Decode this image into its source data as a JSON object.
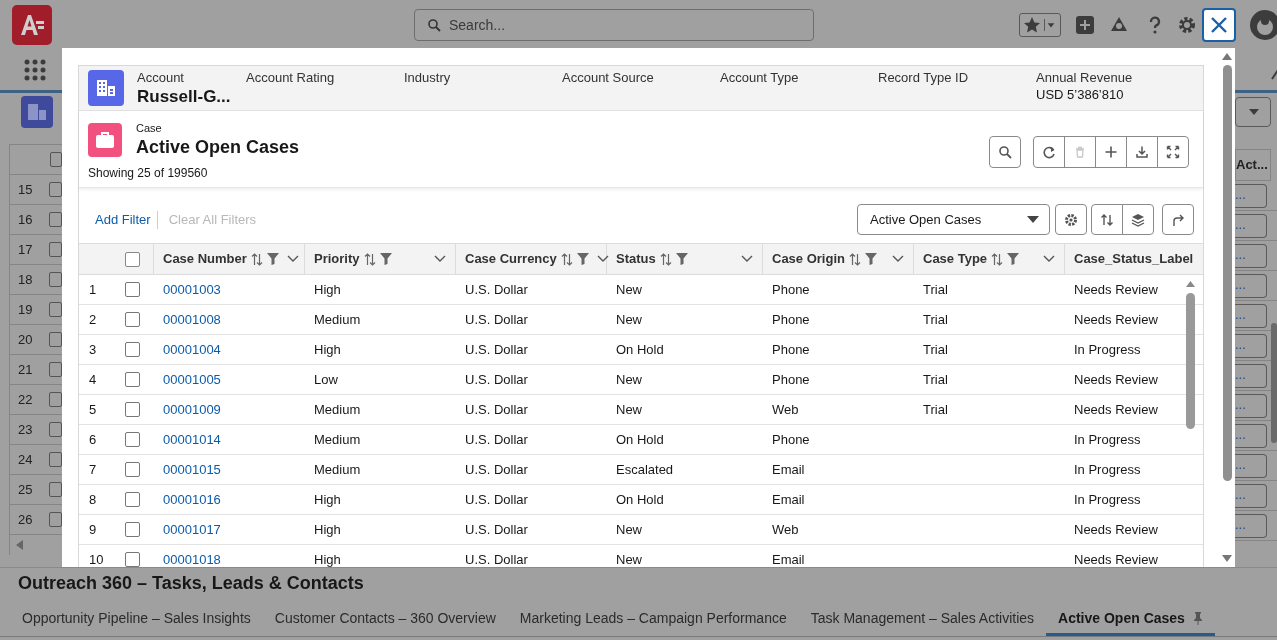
{
  "app": {
    "search_placeholder": "Search...",
    "left_all_checked": false,
    "left_rows": [
      {
        "n": "15",
        "checked": false
      },
      {
        "n": "16",
        "checked": false
      },
      {
        "n": "17",
        "checked": false
      },
      {
        "n": "18",
        "checked": false
      },
      {
        "n": "19",
        "checked": false
      },
      {
        "n": "20",
        "checked": false
      },
      {
        "n": "21",
        "checked": false
      },
      {
        "n": "22",
        "checked": false
      },
      {
        "n": "23",
        "checked": false
      },
      {
        "n": "24",
        "checked": false
      },
      {
        "n": "25",
        "checked": false
      },
      {
        "n": "26",
        "checked": false
      }
    ],
    "right_header": "Act...",
    "right_cells": [
      "...",
      "...",
      "...",
      "...",
      "...",
      "...",
      "...",
      "...",
      "...",
      "...",
      "...",
      "..."
    ],
    "workspace_title": "Outreach 360 – Tasks, Leads & Contacts",
    "tabs": [
      {
        "label": "Opportunity Pipeline – Sales Insights",
        "selected": false,
        "pinned": false
      },
      {
        "label": "Customer Contacts – 360 Overview",
        "selected": false,
        "pinned": false
      },
      {
        "label": "Marketing Leads – Campaign Performance",
        "selected": false,
        "pinned": false
      },
      {
        "label": "Task Management – Sales Activities",
        "selected": false,
        "pinned": false
      },
      {
        "label": "Active Open Cases",
        "selected": true,
        "pinned": true
      }
    ]
  },
  "modal": {
    "account": {
      "type": "Account",
      "name": "Russell-G...",
      "fields": [
        {
          "label": "Account Rating"
        },
        {
          "label": "Industry"
        },
        {
          "label": "Account Source"
        },
        {
          "label": "Account Type"
        },
        {
          "label": "Record Type ID"
        },
        {
          "label": "Annual Revenue",
          "value": "USD 5’386’810"
        }
      ]
    },
    "list": {
      "object": "Case",
      "title": "Active Open Cases",
      "count": "Showing 25 of 199560",
      "toolbar": [
        {
          "kind": "search",
          "disabled": false
        },
        {
          "kind": "refresh",
          "disabled": false
        },
        {
          "kind": "delete",
          "disabled": true
        },
        {
          "kind": "add",
          "disabled": false
        },
        {
          "kind": "download",
          "disabled": false
        },
        {
          "kind": "expand",
          "disabled": false
        }
      ]
    },
    "filters": {
      "add": "Add Filter",
      "clear": "Clear All Filters",
      "clear_disabled": true,
      "view": "Active Open Cases"
    },
    "all_checked": false,
    "columns": [
      {
        "label": "Case Number",
        "sortable": true,
        "filterable": true
      },
      {
        "label": "Priority",
        "sortable": true,
        "filterable": true
      },
      {
        "label": "Case Currency",
        "sortable": true,
        "filterable": true
      },
      {
        "label": "Status",
        "sortable": true,
        "filterable": true
      },
      {
        "label": "Case Origin",
        "sortable": true,
        "filterable": true
      },
      {
        "label": "Case Type",
        "sortable": true,
        "filterable": true
      },
      {
        "label": "Case_Status_Label",
        "sortable": false,
        "filterable": false
      }
    ],
    "rows": [
      {
        "n": "1",
        "checked": false,
        "cells": [
          "00001003",
          "High",
          "U.S. Dollar",
          "New",
          "Phone",
          "Trial",
          "Needs Review"
        ]
      },
      {
        "n": "2",
        "checked": false,
        "cells": [
          "00001008",
          "Medium",
          "U.S. Dollar",
          "New",
          "Phone",
          "Trial",
          "Needs Review"
        ]
      },
      {
        "n": "3",
        "checked": false,
        "cells": [
          "00001004",
          "High",
          "U.S. Dollar",
          "On Hold",
          "Phone",
          "Trial",
          "In Progress"
        ]
      },
      {
        "n": "4",
        "checked": false,
        "cells": [
          "00001005",
          "Low",
          "U.S. Dollar",
          "New",
          "Phone",
          "Trial",
          "Needs Review"
        ]
      },
      {
        "n": "5",
        "checked": false,
        "cells": [
          "00001009",
          "Medium",
          "U.S. Dollar",
          "New",
          "Web",
          "Trial",
          "Needs Review"
        ]
      },
      {
        "n": "6",
        "checked": false,
        "cells": [
          "00001014",
          "Medium",
          "U.S. Dollar",
          "On Hold",
          "Phone",
          null,
          "In Progress"
        ]
      },
      {
        "n": "7",
        "checked": false,
        "cells": [
          "00001015",
          "Medium",
          "U.S. Dollar",
          "Escalated",
          "Email",
          null,
          "In Progress"
        ]
      },
      {
        "n": "8",
        "checked": false,
        "cells": [
          "00001016",
          "High",
          "U.S. Dollar",
          "On Hold",
          "Email",
          null,
          "In Progress"
        ]
      },
      {
        "n": "9",
        "checked": false,
        "cells": [
          "00001017",
          "High",
          "U.S. Dollar",
          "New",
          "Web",
          null,
          "Needs Review"
        ]
      },
      {
        "n": "10",
        "checked": false,
        "cells": [
          "00001018",
          "High",
          "U.S. Dollar",
          "New",
          "Email",
          null,
          "Needs Review"
        ]
      }
    ]
  }
}
